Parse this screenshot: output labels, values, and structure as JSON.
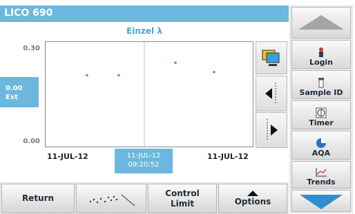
{
  "header": {
    "title": "LICO 690"
  },
  "graph": {
    "subtitle": "Einzel λ",
    "y_top_tick": "0.30",
    "y_bottom_tick": "0.00",
    "current_value": "0.00",
    "current_unit": "Ext",
    "x_left_label": "11-JUL-12",
    "x_right_label": "11-JUL-12",
    "cursor_date": "11-JUL-12",
    "cursor_time": "09:20:52"
  },
  "chart_data": {
    "type": "scatter",
    "ylim": [
      0,
      0.3
    ],
    "points_y": [
      0.22,
      0.22,
      0.26,
      0.23
    ],
    "color": "#4aa3d6"
  },
  "sidebar": {
    "login_label": "Login",
    "sample_id_label": "Sample ID",
    "timer_label": "Timer",
    "aqa_label": "AQA",
    "trends_label": "Trends"
  },
  "bottom": {
    "return_label": "Return",
    "control_limit_line1": "Control",
    "control_limit_line2": "Limit",
    "options_label": "Options"
  }
}
